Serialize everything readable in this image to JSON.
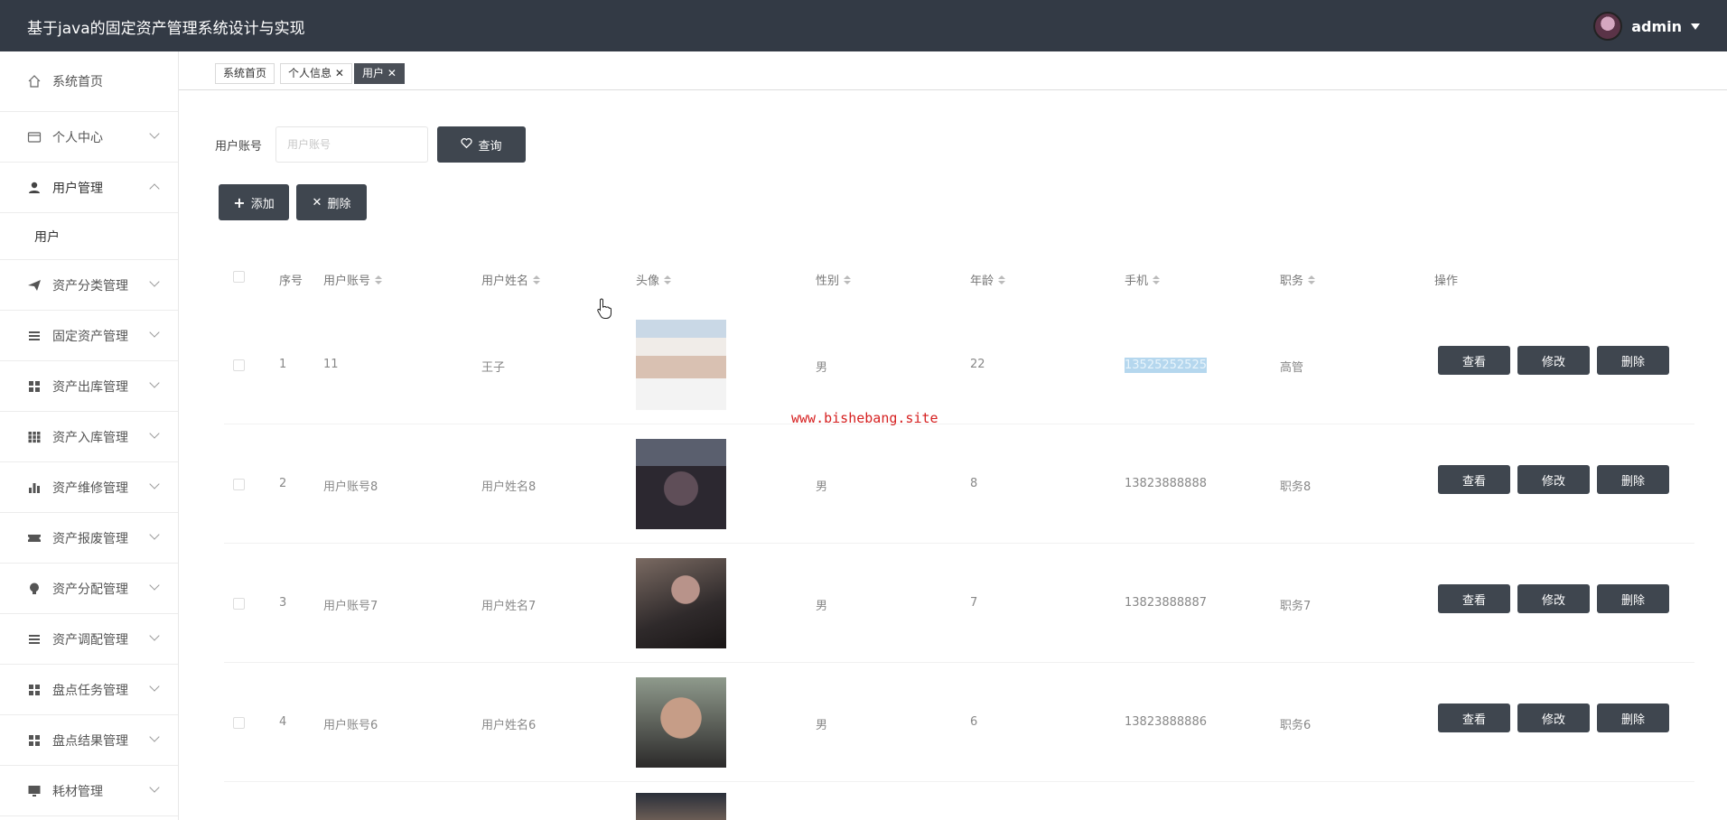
{
  "app": {
    "title": "基于java的固定资产管理系统设计与实现",
    "username": "admin"
  },
  "sidebar": {
    "items": [
      {
        "label": "系统首页",
        "icon": "home-icon"
      },
      {
        "label": "个人中心",
        "icon": "card-icon"
      },
      {
        "label": "用户管理",
        "icon": "user-icon"
      },
      {
        "label": "用户",
        "icon": ""
      },
      {
        "label": "资产分类管理",
        "icon": "send-icon"
      },
      {
        "label": "固定资产管理",
        "icon": "list-icon"
      },
      {
        "label": "资产出库管理",
        "icon": "grid-icon"
      },
      {
        "label": "资产入库管理",
        "icon": "grid-icon"
      },
      {
        "label": "资产维修管理",
        "icon": "bar-chart-icon"
      },
      {
        "label": "资产报废管理",
        "icon": "ticket-icon"
      },
      {
        "label": "资产分配管理",
        "icon": "bulb-icon"
      },
      {
        "label": "资产调配管理",
        "icon": "list-icon"
      },
      {
        "label": "盘点任务管理",
        "icon": "grid-icon"
      },
      {
        "label": "盘点结果管理",
        "icon": "grid-icon"
      },
      {
        "label": "耗材管理",
        "icon": "monitor-icon"
      }
    ]
  },
  "tabs": [
    {
      "label": "系统首页"
    },
    {
      "label": "个人信息"
    },
    {
      "label": "用户"
    }
  ],
  "search": {
    "label": "用户账号",
    "placeholder": "用户账号",
    "button": "查询"
  },
  "actions": {
    "add": "添加",
    "delete": "删除"
  },
  "table": {
    "headers": {
      "index": "序号",
      "account": "用户账号",
      "name": "用户姓名",
      "avatar": "头像",
      "gender": "性别",
      "age": "年龄",
      "phone": "手机",
      "position": "职务",
      "ops": "操作"
    },
    "rows": [
      {
        "index": "1",
        "account": "11",
        "name": "王子",
        "gender": "男",
        "age": "22",
        "phone": "13525252525",
        "position": "高管"
      },
      {
        "index": "2",
        "account": "用户账号8",
        "name": "用户姓名8",
        "gender": "男",
        "age": "8",
        "phone": "13823888888",
        "position": "职务8"
      },
      {
        "index": "3",
        "account": "用户账号7",
        "name": "用户姓名7",
        "gender": "男",
        "age": "7",
        "phone": "13823888887",
        "position": "职务7"
      },
      {
        "index": "4",
        "account": "用户账号6",
        "name": "用户姓名6",
        "gender": "男",
        "age": "6",
        "phone": "13823888886",
        "position": "职务6"
      }
    ],
    "row_buttons": {
      "view": "查看",
      "edit": "修改",
      "delete": "删除"
    }
  },
  "watermark": "www.bishebang.site",
  "colors": {
    "topbar": "#333a45",
    "button": "#3f464f",
    "watermark": "#d62020"
  }
}
